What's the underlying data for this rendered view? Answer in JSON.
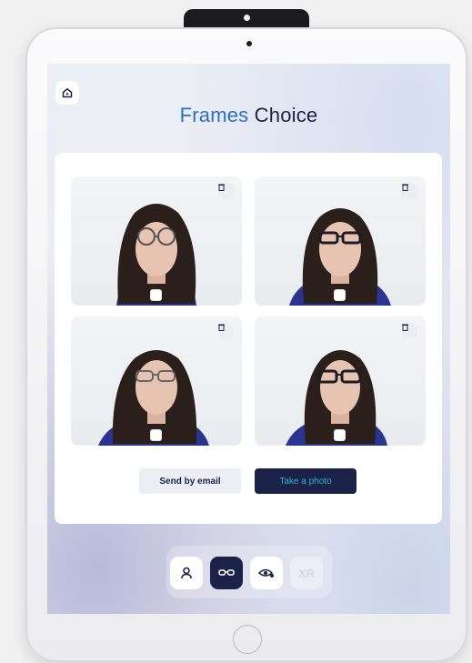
{
  "app": {
    "title_accent": "Frames",
    "title_rest": " Choice"
  },
  "photos": [
    {
      "name": "photo-1",
      "selected": false
    },
    {
      "name": "photo-2",
      "selected": false
    },
    {
      "name": "photo-3",
      "selected": false
    },
    {
      "name": "photo-4",
      "selected": false
    }
  ],
  "actions": {
    "send_email_label": "Send by email",
    "take_photo_label": "Take a photo"
  },
  "toolbar": {
    "items": [
      {
        "icon": "person-icon",
        "active": false
      },
      {
        "icon": "glasses-icon",
        "active": true
      },
      {
        "icon": "eye-icon",
        "active": false
      },
      {
        "icon": "xr-icon",
        "active": false,
        "label": "XR"
      }
    ]
  },
  "colors": {
    "accent": "#2c6fc4",
    "navy": "#1c2148",
    "cta_text": "#33b4ce"
  }
}
